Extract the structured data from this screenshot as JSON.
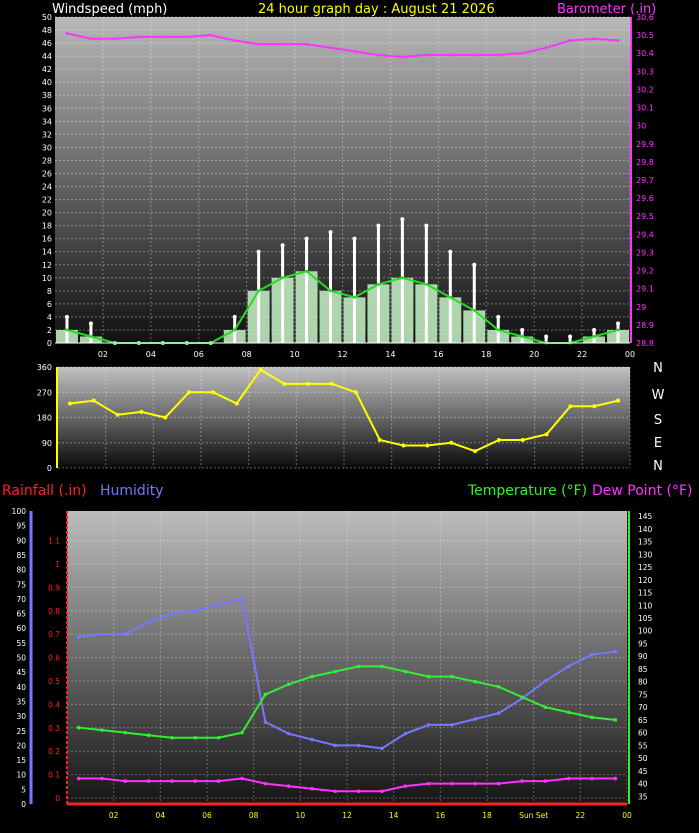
{
  "header": {
    "title": "24 hour graph day : August 21 2026",
    "windspeed_label": "Windspeed (mph)",
    "barometer_label": "Barometer (.in)"
  },
  "colors": {
    "bg": "#000000",
    "title": "#ffff00",
    "wind_label": "#ffffff",
    "baro": "#ff33ff",
    "gust": "#ffffff",
    "avg_wind": "#22dd22",
    "wind_fill": "#c8f5c8",
    "direction": "#ffff00",
    "rain": "#ff2020",
    "humidity": "#7777ff",
    "temperature": "#33ee33",
    "dewpoint": "#ff33ff"
  },
  "chart_data": [
    {
      "type": "line",
      "name": "wind-barometer",
      "x": [
        "01",
        "02",
        "03",
        "04",
        "05",
        "06",
        "07",
        "08",
        "09",
        "10",
        "11",
        "12",
        "13",
        "14",
        "15",
        "16",
        "17",
        "18",
        "19",
        "20",
        "21",
        "22",
        "23",
        "00"
      ],
      "x_ticks": [
        "02",
        "04",
        "06",
        "08",
        "10",
        "12",
        "14",
        "16",
        "18",
        "20",
        "22",
        "00"
      ],
      "ylabel": "Windspeed (mph)",
      "ylim": [
        0,
        50
      ],
      "y_ticks": [
        0,
        2,
        4,
        6,
        8,
        10,
        12,
        14,
        16,
        18,
        20,
        22,
        24,
        26,
        28,
        30,
        32,
        34,
        36,
        38,
        40,
        42,
        44,
        46,
        48,
        50
      ],
      "y2label": "Barometer (.in)",
      "y2lim": [
        28.8,
        30.6
      ],
      "y2_ticks": [
        "28.8",
        "28.9",
        "29",
        "29.1",
        "29.2",
        "29.3",
        "29.4",
        "29.5",
        "29.6",
        "29.7",
        "29.8",
        "29.9",
        "30",
        "30.1",
        "30.2",
        "30.3",
        "30.4",
        "30.5",
        "30.6"
      ],
      "series": [
        {
          "name": "gust",
          "values": [
            4,
            3,
            0,
            0,
            0,
            0,
            0,
            4,
            14,
            15,
            16,
            17,
            16,
            18,
            19,
            18,
            14,
            12,
            4,
            2,
            1,
            1,
            2,
            3
          ]
        },
        {
          "name": "avg wind",
          "values": [
            2,
            1,
            0,
            0,
            0,
            0,
            0,
            2,
            8,
            10,
            11,
            8,
            7,
            9,
            10,
            9,
            7,
            5,
            2,
            1,
            0,
            0,
            1,
            2
          ]
        },
        {
          "name": "barometer",
          "values": [
            30.51,
            30.48,
            30.48,
            30.49,
            30.49,
            30.49,
            30.5,
            30.47,
            30.45,
            30.45,
            30.45,
            30.43,
            30.41,
            30.39,
            30.38,
            30.39,
            30.39,
            30.39,
            30.39,
            30.4,
            30.43,
            30.47,
            30.48,
            30.47
          ]
        }
      ],
      "grid": true
    },
    {
      "type": "scatter",
      "name": "wind-direction",
      "x": [
        "01",
        "02",
        "03",
        "04",
        "05",
        "06",
        "07",
        "08",
        "09",
        "10",
        "11",
        "12",
        "13",
        "14",
        "15",
        "16",
        "17",
        "18",
        "19",
        "20",
        "21",
        "22",
        "23",
        "00"
      ],
      "ylim": [
        0,
        360
      ],
      "y_ticks": [
        0,
        90,
        180,
        270,
        360
      ],
      "compass_labels": [
        "N",
        "W",
        "S",
        "E",
        "N"
      ],
      "series": [
        {
          "name": "direction",
          "values": [
            230,
            240,
            190,
            200,
            180,
            270,
            270,
            230,
            350,
            300,
            300,
            300,
            270,
            100,
            80,
            80,
            90,
            60,
            100,
            100,
            120,
            220,
            220,
            240
          ]
        }
      ],
      "grid": true
    },
    {
      "type": "line",
      "name": "rain-humidity-temperature",
      "x": [
        "01",
        "02",
        "03",
        "04",
        "05",
        "06",
        "07",
        "08",
        "09",
        "10",
        "11",
        "12",
        "13",
        "14",
        "15",
        "16",
        "17",
        "18",
        "19",
        "20",
        "21",
        "22",
        "23",
        "00"
      ],
      "x_ticks": [
        "02",
        "04",
        "06",
        "08",
        "10",
        "12",
        "14",
        "16",
        "18",
        "Sun Set",
        "22",
        "00"
      ],
      "labels": {
        "rainfall": "Rainfall (.in)",
        "humidity": "Humidity",
        "temp_dew": "Temperature (°F)",
        "dew": "Dew Point (°F)"
      },
      "rain_ticks": [
        "0",
        "0.1",
        "0.2",
        "0.3",
        "0.4",
        "0.5",
        "0.6",
        "0.7",
        "0.8",
        "0.9",
        "1",
        "1.1"
      ],
      "humidity_ticks": [
        0,
        5,
        10,
        15,
        20,
        25,
        30,
        35,
        40,
        45,
        50,
        55,
        60,
        65,
        70,
        75,
        80,
        85,
        90,
        95,
        100
      ],
      "temp_ticks": [
        35,
        40,
        45,
        50,
        55,
        60,
        65,
        70,
        75,
        80,
        85,
        90,
        95,
        100,
        105,
        110,
        115,
        120,
        125,
        130,
        135,
        140,
        145
      ],
      "humidity_lim": [
        0,
        100
      ],
      "temp_lim": [
        32,
        147
      ],
      "series": [
        {
          "name": "Humidity",
          "values": [
            57,
            58,
            58,
            62,
            65,
            66,
            68,
            70,
            28,
            24,
            22,
            20,
            20,
            19,
            24,
            27,
            27,
            29,
            31,
            36,
            42,
            47,
            51,
            52
          ]
        },
        {
          "name": "Temperature",
          "values": [
            62,
            61,
            60,
            59,
            58,
            58,
            58,
            60,
            75,
            79,
            82,
            84,
            86,
            86,
            84,
            82,
            82,
            80,
            78,
            74,
            70,
            68,
            66,
            65
          ]
        },
        {
          "name": "Dew Point",
          "values": [
            42,
            42,
            41,
            41,
            41,
            41,
            41,
            42,
            40,
            39,
            38,
            37,
            37,
            37,
            39,
            40,
            40,
            40,
            40,
            41,
            41,
            42,
            42,
            42
          ]
        },
        {
          "name": "Rainfall",
          "values": [
            0,
            0,
            0,
            0,
            0,
            0,
            0,
            0,
            0,
            0,
            0,
            0,
            0,
            0,
            0,
            0,
            0,
            0,
            0,
            0,
            0,
            0,
            0,
            0
          ]
        }
      ],
      "grid": true
    }
  ]
}
